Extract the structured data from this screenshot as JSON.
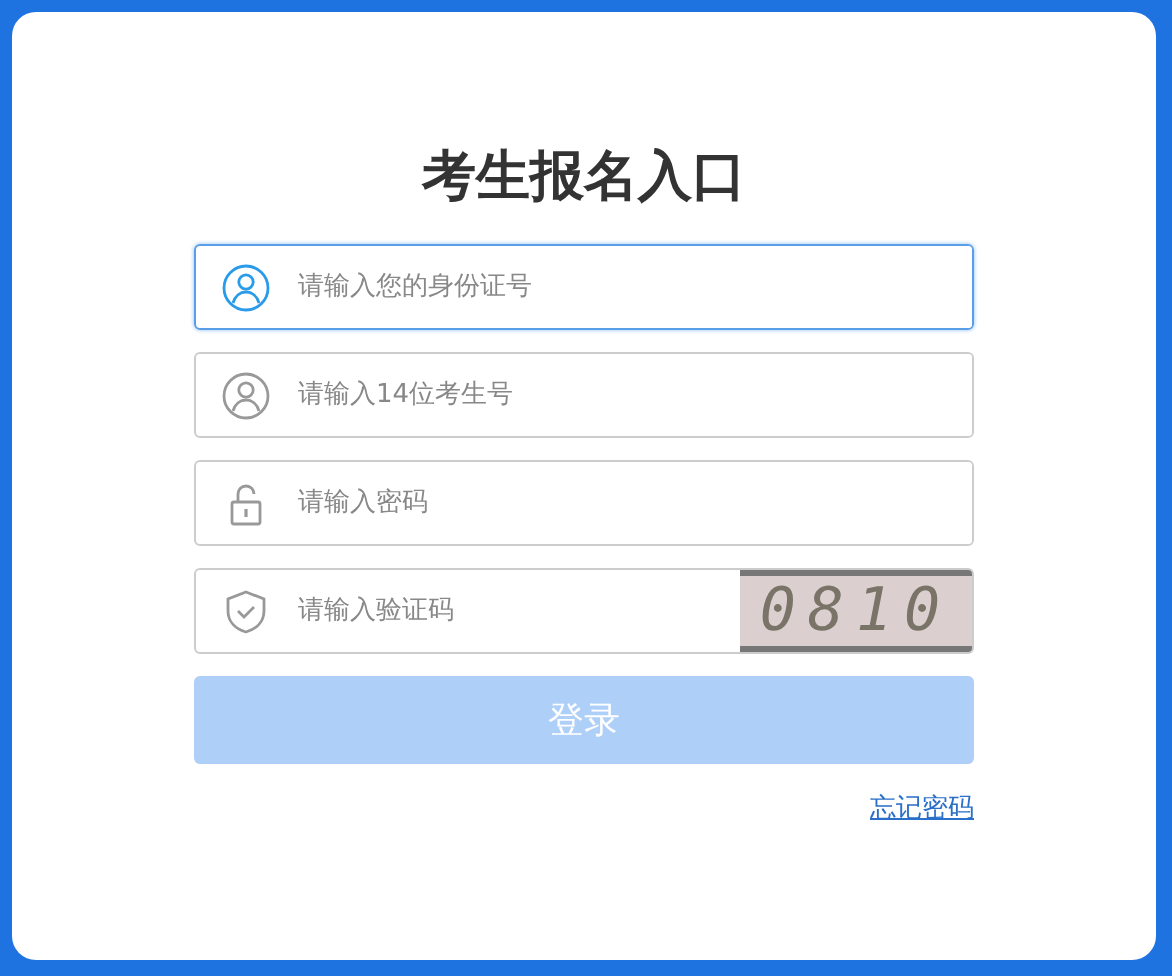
{
  "title": "考生报名入口",
  "fields": [
    {
      "kind": "user",
      "placeholder": "请输入您的身份证号",
      "focused": true
    },
    {
      "kind": "user",
      "placeholder": "请输入14位考生号",
      "focused": false
    },
    {
      "kind": "lock",
      "placeholder": "请输入密码",
      "focused": false
    },
    {
      "kind": "shield",
      "placeholder": "请输入验证码",
      "focused": false,
      "captcha": "0810"
    }
  ],
  "login_button": {
    "label": "登录",
    "disabled": true
  },
  "forgot_link": "忘记密码"
}
